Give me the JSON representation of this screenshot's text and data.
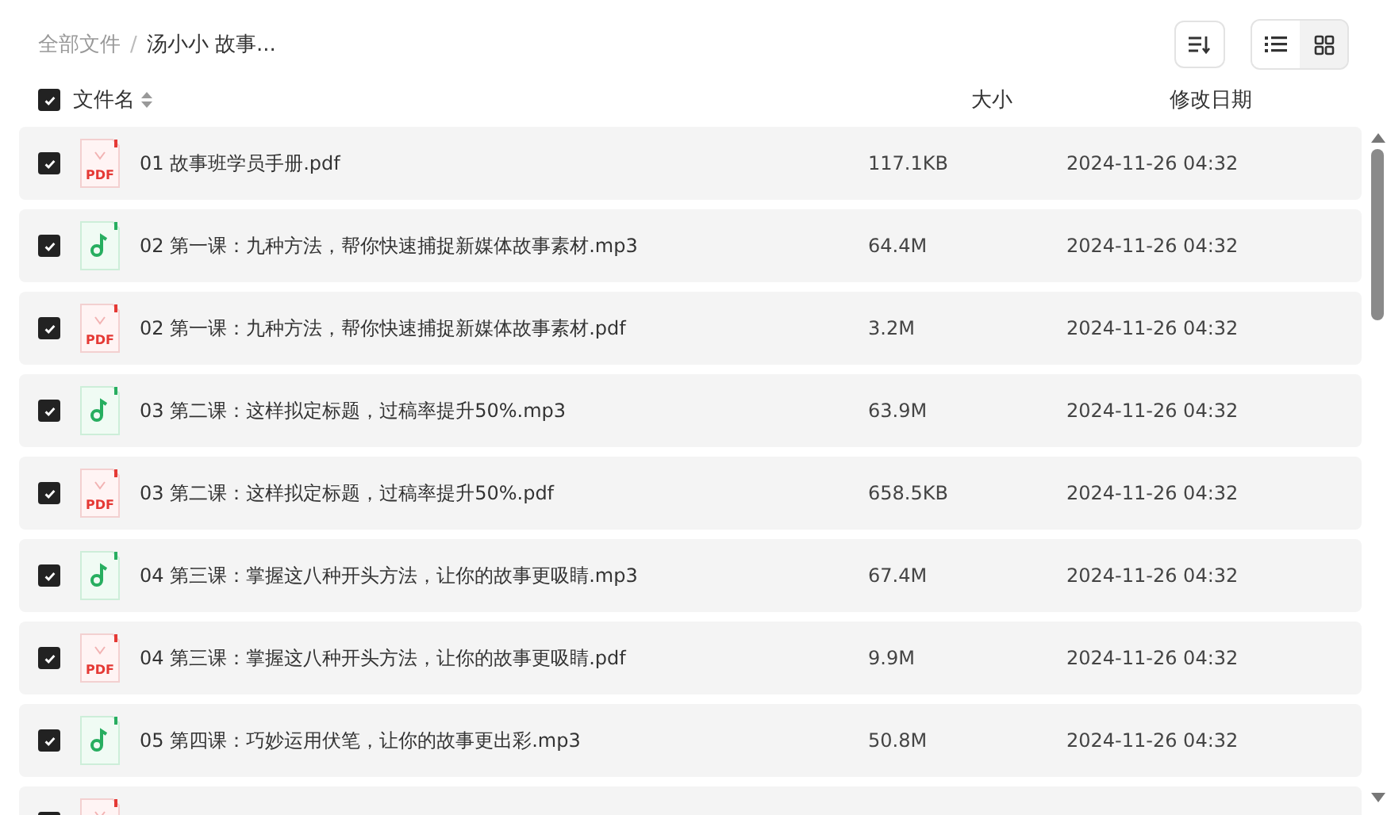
{
  "breadcrumb": [
    {
      "label": "全部文件",
      "current": false
    },
    {
      "label": "汤小小 故事...",
      "current": true
    }
  ],
  "breadcrumb_separator": "/",
  "toolbar": {
    "view_modes": [
      {
        "kind": "list",
        "selected": true
      },
      {
        "kind": "grid",
        "selected": false
      }
    ]
  },
  "table": {
    "select_all": {
      "checked": true
    },
    "columns": [
      {
        "label": "文件名",
        "sortable": true
      },
      {
        "label": "大小",
        "sortable": false
      },
      {
        "label": "修改日期",
        "sortable": false
      }
    ],
    "rows": [
      {
        "kind": "pdf",
        "icon_label": "PDF",
        "checked": true,
        "name": "01 故事班学员手册.pdf",
        "size": "117.1KB",
        "date": "2024-11-26 04:32"
      },
      {
        "kind": "audio",
        "checked": true,
        "name": "02 第一课：九种方法，帮你快速捕捉新媒体故事素材.mp3",
        "size": "64.4M",
        "date": "2024-11-26 04:32"
      },
      {
        "kind": "pdf",
        "icon_label": "PDF",
        "checked": true,
        "name": "02 第一课：九种方法，帮你快速捕捉新媒体故事素材.pdf",
        "size": "3.2M",
        "date": "2024-11-26 04:32"
      },
      {
        "kind": "audio",
        "checked": true,
        "name": "03 第二课：这样拟定标题，过稿率提升50%.mp3",
        "size": "63.9M",
        "date": "2024-11-26 04:32"
      },
      {
        "kind": "pdf",
        "icon_label": "PDF",
        "checked": true,
        "name": "03 第二课：这样拟定标题，过稿率提升50%.pdf",
        "size": "658.5KB",
        "date": "2024-11-26 04:32"
      },
      {
        "kind": "audio",
        "checked": true,
        "name": "04 第三课：掌握这八种开头方法，让你的故事更吸睛.mp3",
        "size": "67.4M",
        "date": "2024-11-26 04:32"
      },
      {
        "kind": "pdf",
        "icon_label": "PDF",
        "checked": true,
        "name": "04 第三课：掌握这八种开头方法，让你的故事更吸睛.pdf",
        "size": "9.9M",
        "date": "2024-11-26 04:32"
      },
      {
        "kind": "audio",
        "checked": true,
        "name": "05 第四课：巧妙运用伏笔，让你的故事更出彩.mp3",
        "size": "50.8M",
        "date": "2024-11-26 04:32"
      },
      {
        "kind": "pdf",
        "checked": true
      }
    ]
  }
}
